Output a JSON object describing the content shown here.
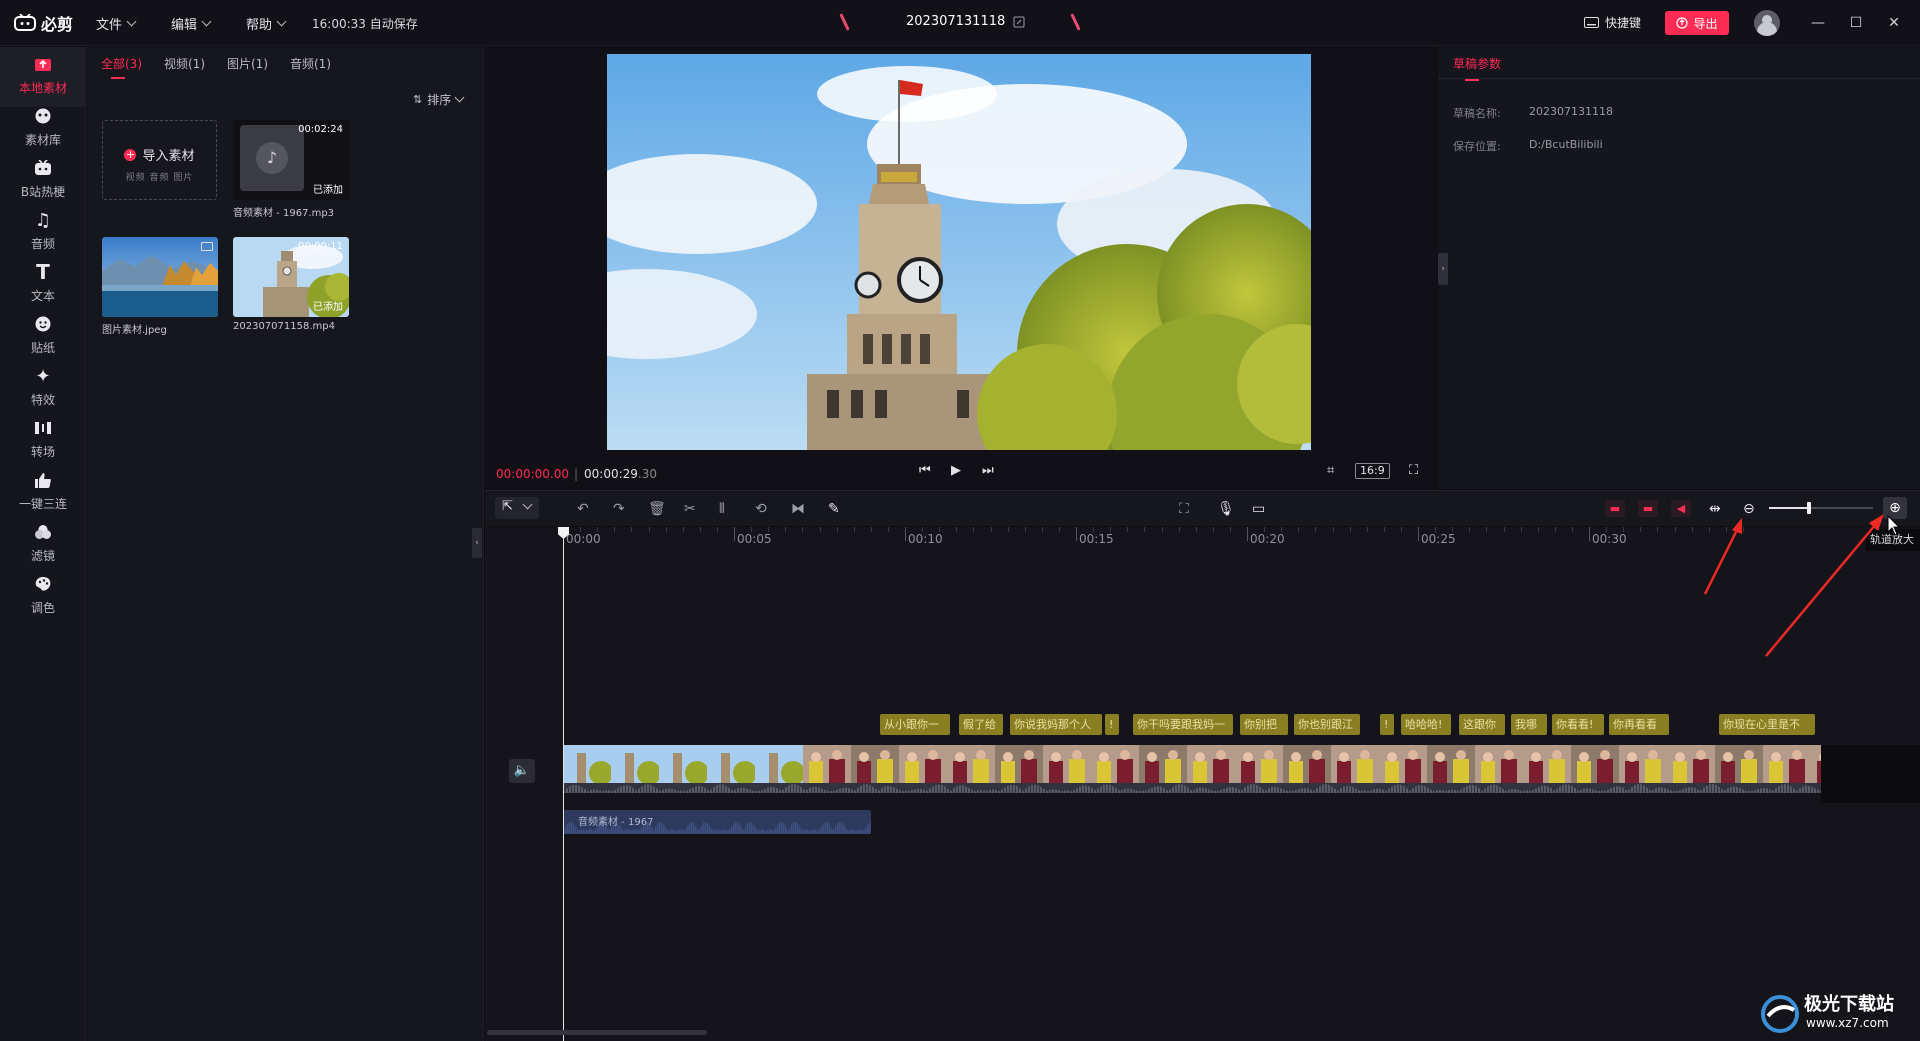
{
  "titlebar": {
    "logo_text": "必剪",
    "menus": [
      {
        "label": "文件"
      },
      {
        "label": "编辑"
      },
      {
        "label": "帮助"
      }
    ],
    "autosave": "16:00:33 自动保存",
    "project_name": "202307131118",
    "shortcut_label": "快捷键",
    "export_label": "导出",
    "colors": {
      "accent": "#fe2c55",
      "background": "#111117"
    }
  },
  "rail": {
    "items": [
      {
        "label": "本地素材",
        "icon": "upload-folder-icon",
        "active": true
      },
      {
        "label": "素材库",
        "icon": "bilibili-face-icon"
      },
      {
        "label": "B站热梗",
        "icon": "tv-icon"
      },
      {
        "label": "音频",
        "icon": "music-note-icon"
      },
      {
        "label": "文本",
        "icon": "text-t-icon"
      },
      {
        "label": "贴纸",
        "icon": "sticker-icon"
      },
      {
        "label": "特效",
        "icon": "sparkle-icon"
      },
      {
        "label": "转场",
        "icon": "transition-icon"
      },
      {
        "label": "一键三连",
        "icon": "thumb-up-icon"
      },
      {
        "label": "滤镜",
        "icon": "filter-icon"
      },
      {
        "label": "调色",
        "icon": "palette-icon"
      }
    ]
  },
  "media": {
    "tabs": [
      {
        "label": "全部(3)",
        "active": true
      },
      {
        "label": "视频(1)"
      },
      {
        "label": "图片(1)"
      },
      {
        "label": "音频(1)"
      }
    ],
    "sort_label": "排序",
    "import": {
      "label": "导入素材",
      "hint": "视频 音频 图片"
    },
    "items": [
      {
        "name": "音频素材 - 1967.mp3",
        "duration": "00:02:24",
        "status": "已添加",
        "type": "audio"
      },
      {
        "name": "图片素材.jpeg",
        "type": "image"
      },
      {
        "name": "202307071158.mp4",
        "duration": "00:00:11",
        "status": "已添加",
        "type": "video"
      }
    ]
  },
  "preview": {
    "current_time": "00:00:00.00",
    "total_time": "00:00:29",
    "total_frames": ".30",
    "aspect_ratio": "16:9"
  },
  "props": {
    "tab": "草稿参数",
    "name_label": "草稿名称:",
    "name_value": "202307131118",
    "path_label": "保存位置:",
    "path_value": "D:/BcutBilibili"
  },
  "timeline": {
    "ruler_labels": [
      "00:00",
      "00:05",
      "00:10",
      "00:15",
      "00:20",
      "00:25",
      "00:30"
    ],
    "zoom_level": 0.38,
    "zoom_tooltip": "轨道放大",
    "captions": [
      "从小跟你一",
      "假了给",
      "你说我妈那个人",
      "!",
      "你干吗要跟我妈一",
      "你别把",
      "你也别跟江",
      "!",
      "哈哈哈!",
      "这跟你",
      "我哪",
      "你看看!",
      "你再看看",
      "你现在心里是不"
    ],
    "audio_clip_label": "音频素材 - 1967"
  },
  "watermark": {
    "site_name": "极光下载站",
    "url": "www.xz7.com"
  }
}
